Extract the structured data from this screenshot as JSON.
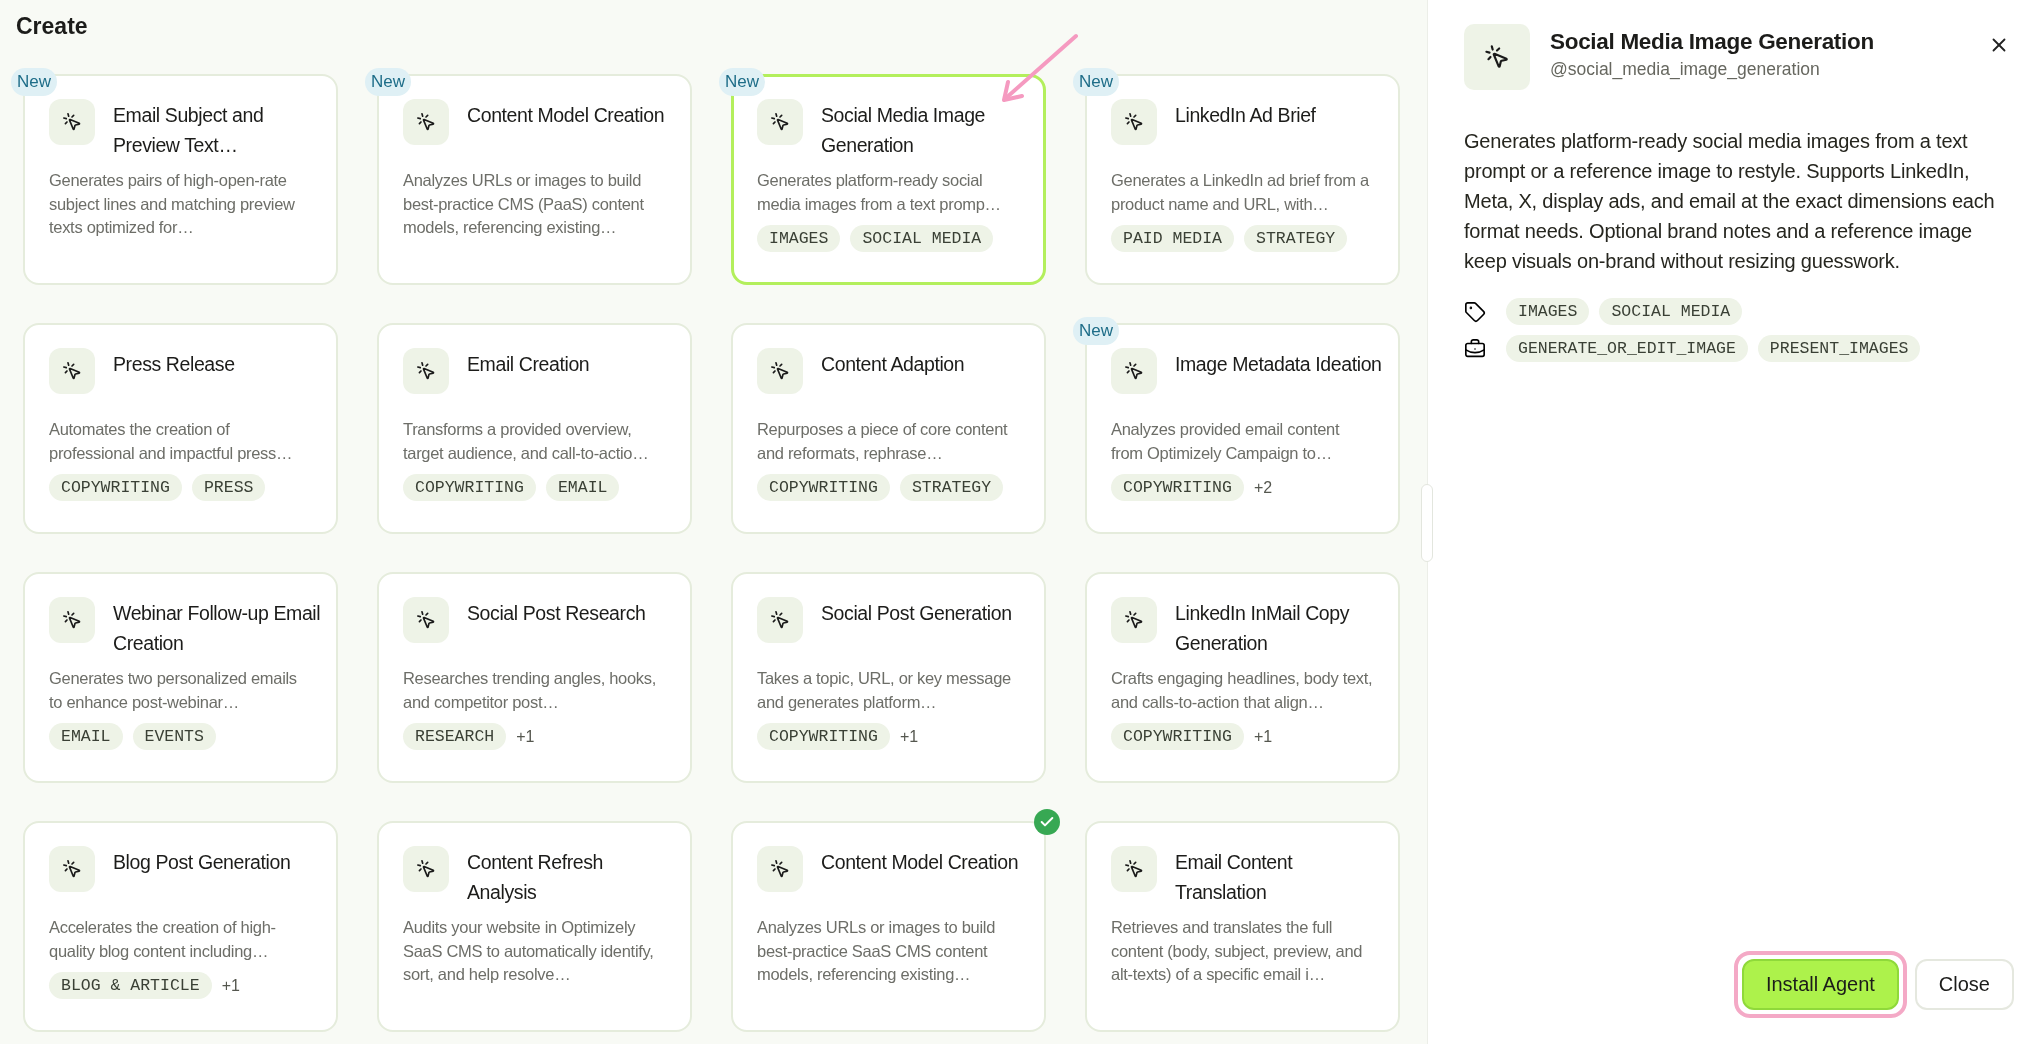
{
  "page": {
    "title": "Create"
  },
  "cards": [
    {
      "title": "Email Subject and Preview Text…",
      "description": "Generates pairs of high-open-rate subject lines and matching preview texts optimized for…",
      "badge": "New",
      "selected": false,
      "installed": false
    },
    {
      "title": "Content Model Creation",
      "description": "Analyzes URLs or images to build best-practice CMS (PaaS) content models, referencing existing…",
      "badge": "New",
      "selected": false,
      "installed": false
    },
    {
      "title": "Social Media Image Generation",
      "description": "Generates platform-ready social media images from a text promp…",
      "tags": [
        "IMAGES",
        "SOCIAL MEDIA"
      ],
      "badge": "New",
      "selected": true,
      "installed": false
    },
    {
      "title": "LinkedIn Ad Brief",
      "description": "Generates a LinkedIn ad brief from a product name and URL, with…",
      "tags": [
        "PAID MEDIA",
        "STRATEGY"
      ],
      "badge": "New",
      "selected": false,
      "installed": false
    },
    {
      "title": "Press Release",
      "description": "Automates the creation of professional and impactful press…",
      "tags": [
        "COPYWRITING",
        "PRESS"
      ],
      "selected": false,
      "installed": false
    },
    {
      "title": "Email Creation",
      "description": "Transforms a provided overview, target audience, and call-to-actio…",
      "tags": [
        "COPYWRITING",
        "EMAIL"
      ],
      "selected": false,
      "installed": false
    },
    {
      "title": "Content Adaption",
      "description": "Repurposes a piece of core content and reformats, rephrase…",
      "tags": [
        "COPYWRITING",
        "STRATEGY"
      ],
      "selected": false,
      "installed": false
    },
    {
      "title": "Image Metadata Ideation",
      "description": "Analyzes provided email content from Optimizely Campaign to…",
      "tags": [
        "COPYWRITING"
      ],
      "more": "+2",
      "badge": "New",
      "selected": false,
      "installed": false
    },
    {
      "title": "Webinar Follow-up Email Creation",
      "description": "Generates two personalized emails to enhance post-webinar…",
      "tags": [
        "EMAIL",
        "EVENTS"
      ],
      "selected": false,
      "installed": false
    },
    {
      "title": "Social Post Research",
      "description": "Researches trending angles, hooks, and competitor post…",
      "tags": [
        "RESEARCH"
      ],
      "more": "+1",
      "selected": false,
      "installed": false
    },
    {
      "title": "Social Post Generation",
      "description": "Takes a topic, URL, or key message and generates platform…",
      "tags": [
        "COPYWRITING"
      ],
      "more": "+1",
      "selected": false,
      "installed": false
    },
    {
      "title": "LinkedIn InMail Copy Generation",
      "description": "Crafts engaging headlines, body text, and calls-to-action that align…",
      "tags": [
        "COPYWRITING"
      ],
      "more": "+1",
      "selected": false,
      "installed": false
    },
    {
      "title": "Blog Post Generation",
      "description": "Accelerates the creation of high-quality blog content including…",
      "tags": [
        "BLOG & ARTICLE"
      ],
      "more": "+1",
      "selected": false,
      "installed": false
    },
    {
      "title": "Content Refresh Analysis",
      "description": "Audits your website in Optimizely SaaS CMS to automatically identify, sort, and help resolve…",
      "selected": false,
      "installed": false
    },
    {
      "title": "Content Model Creation",
      "description": "Analyzes URLs or images to build best-practice SaaS CMS content models, referencing existing…",
      "selected": false,
      "installed": true
    },
    {
      "title": "Email Content Translation",
      "description": "Retrieves and translates the full content (body, subject, preview, and alt-texts) of a specific email i…",
      "selected": false,
      "installed": false
    }
  ],
  "panel": {
    "title": "Social Media Image Generation",
    "handle": "@social_media_image_generation",
    "description": "Generates platform-ready social media images from a text prompt or a reference image to restyle. Supports LinkedIn, Meta, X, display ads, and email at the exact dimensions each format needs. Optional brand notes and a reference image keep visuals on-brand without resizing guesswork.",
    "tags": [
      "IMAGES",
      "SOCIAL MEDIA"
    ],
    "tools": [
      "GENERATE_OR_EDIT_IMAGE",
      "PRESENT_IMAGES"
    ],
    "buttons": [
      {
        "label": "Install Agent",
        "kind": "primary",
        "highlighted": true
      },
      {
        "label": "Close",
        "kind": "secondary",
        "highlighted": false
      }
    ]
  }
}
